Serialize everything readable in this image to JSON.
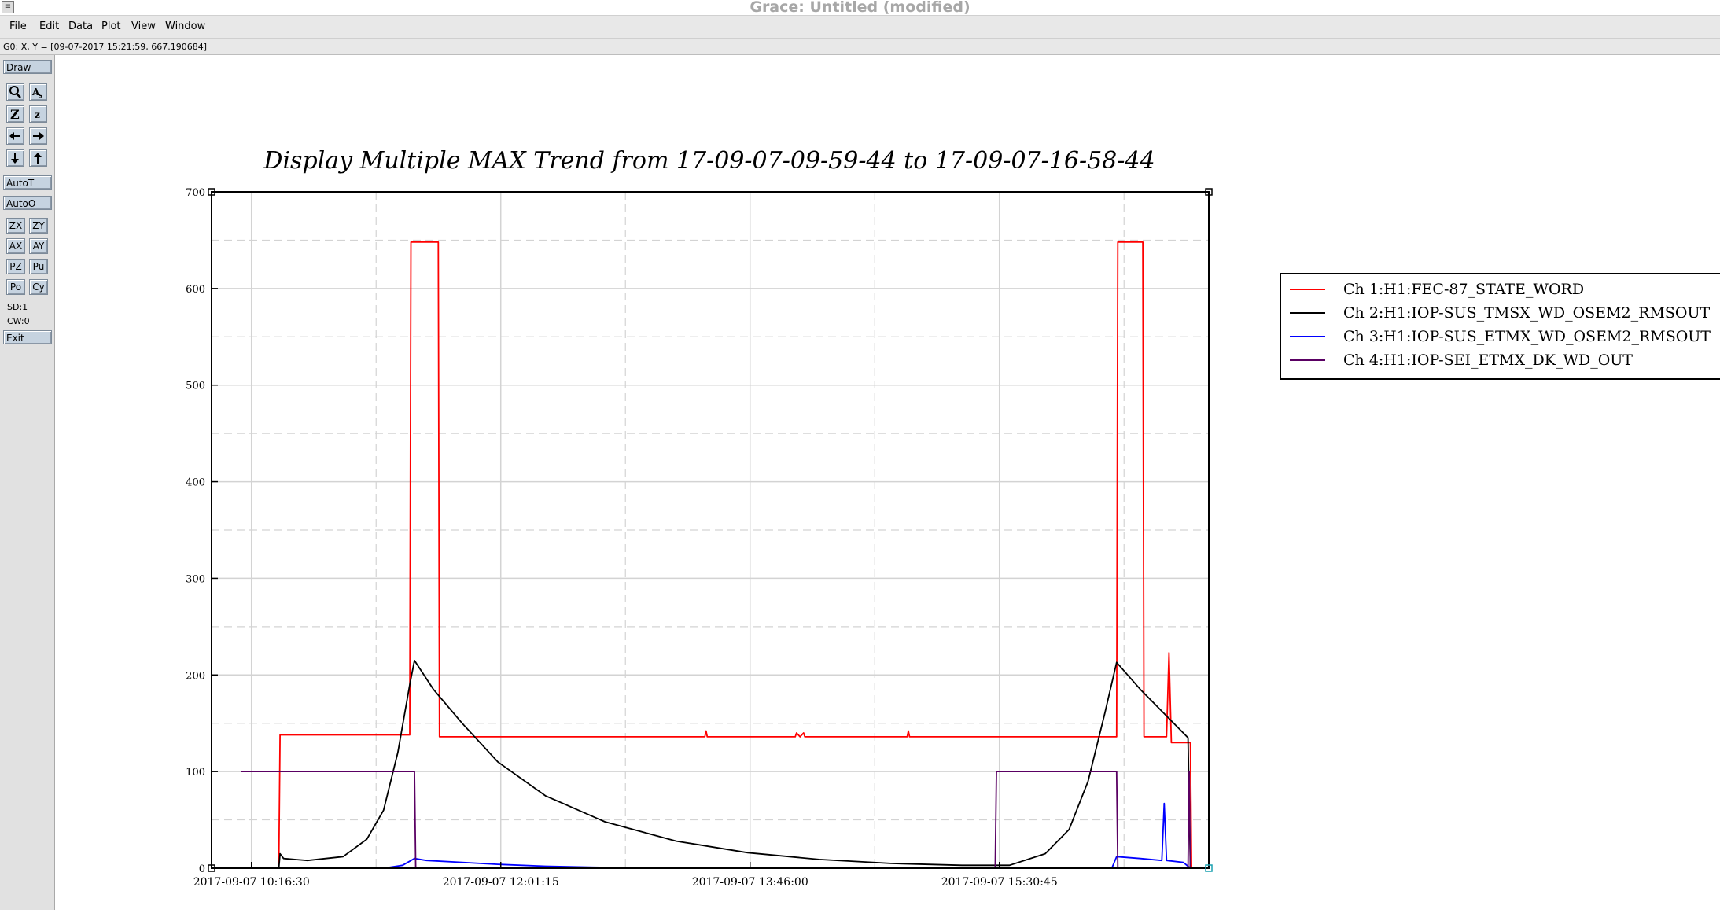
{
  "window": {
    "title": "Grace: Untitled (modified)"
  },
  "menu": {
    "items": [
      "File",
      "Edit",
      "Data",
      "Plot",
      "View",
      "Window"
    ]
  },
  "status": {
    "locator": "G0: X, Y = [09-07-2017 15:21:59, 667.190684]"
  },
  "toolbar": {
    "draw": "Draw",
    "autot": "AutoT",
    "autoo": "AutoO",
    "zx": "ZX",
    "zy": "ZY",
    "ax": "AX",
    "ay": "AY",
    "pz": "PZ",
    "pu": "Pu",
    "po": "Po",
    "cy": "Cy",
    "sd": "SD:1",
    "cw": "CW:0",
    "exit": "Exit",
    "icons": [
      "zoom-icon",
      "zoom-text-icon",
      "zoom-x-icon",
      "zoom-y-icon",
      "scroll-left-icon",
      "scroll-right-icon",
      "scroll-down-icon",
      "scroll-up-icon"
    ]
  },
  "chart_data": {
    "type": "line",
    "title": "Display Multiple MAX Trend from 17-09-07-09-59-44 to 17-09-07-16-58-44",
    "xlabel": "",
    "ylabel": "",
    "ylim": [
      0,
      700
    ],
    "yticks": [
      0,
      100,
      200,
      300,
      400,
      500,
      600,
      700
    ],
    "xlim": [
      "2017-09-07 09:59:44",
      "2017-09-07 16:58:44"
    ],
    "xtick_labels": [
      "2017-09-07 10:16:30",
      "2017-09-07 12:01:15",
      "2017-09-07 13:46:00",
      "2017-09-07 15:30:45"
    ],
    "grid": true,
    "legend_position": "right",
    "series": [
      {
        "name": "Ch 1:H1:FEC-87_STATE_WORD",
        "color": "#ff0000",
        "points": [
          [
            "2017-09-07 10:28:00",
            0
          ],
          [
            "2017-09-07 10:28:30",
            138
          ],
          [
            "2017-09-07 11:23:00",
            138
          ],
          [
            "2017-09-07 11:23:30",
            648
          ],
          [
            "2017-09-07 11:35:00",
            648
          ],
          [
            "2017-09-07 11:35:30",
            136
          ],
          [
            "2017-09-07 13:27:00",
            136
          ],
          [
            "2017-09-07 13:27:30",
            142
          ],
          [
            "2017-09-07 13:28:00",
            136
          ],
          [
            "2017-09-07 14:05:00",
            136
          ],
          [
            "2017-09-07 14:05:30",
            140
          ],
          [
            "2017-09-07 14:07:00",
            136
          ],
          [
            "2017-09-07 14:08:30",
            140
          ],
          [
            "2017-09-07 14:09:00",
            136
          ],
          [
            "2017-09-07 14:52:00",
            136
          ],
          [
            "2017-09-07 14:52:30",
            142
          ],
          [
            "2017-09-07 14:53:00",
            136
          ],
          [
            "2017-09-07 16:20:00",
            136
          ],
          [
            "2017-09-07 16:20:30",
            648
          ],
          [
            "2017-09-07 16:31:00",
            648
          ],
          [
            "2017-09-07 16:31:30",
            136
          ],
          [
            "2017-09-07 16:41:00",
            136
          ],
          [
            "2017-09-07 16:42:00",
            223
          ],
          [
            "2017-09-07 16:43:00",
            130
          ],
          [
            "2017-09-07 16:51:00",
            130
          ],
          [
            "2017-09-07 16:51:30",
            0
          ]
        ]
      },
      {
        "name": "Ch 2:H1:IOP-SUS_TMSX_WD_OSEM2_RMSOUT",
        "color": "#000000",
        "points": [
          [
            "2017-09-07 10:28:00",
            0
          ],
          [
            "2017-09-07 10:28:30",
            15
          ],
          [
            "2017-09-07 10:30:00",
            10
          ],
          [
            "2017-09-07 10:40:00",
            8
          ],
          [
            "2017-09-07 10:55:00",
            12
          ],
          [
            "2017-09-07 11:05:00",
            30
          ],
          [
            "2017-09-07 11:12:00",
            60
          ],
          [
            "2017-09-07 11:18:00",
            120
          ],
          [
            "2017-09-07 11:23:00",
            190
          ],
          [
            "2017-09-07 11:25:00",
            215
          ],
          [
            "2017-09-07 11:33:00",
            185
          ],
          [
            "2017-09-07 11:45:00",
            150
          ],
          [
            "2017-09-07 12:00:00",
            110
          ],
          [
            "2017-09-07 12:20:00",
            75
          ],
          [
            "2017-09-07 12:45:00",
            48
          ],
          [
            "2017-09-07 13:15:00",
            28
          ],
          [
            "2017-09-07 13:45:00",
            16
          ],
          [
            "2017-09-07 14:15:00",
            9
          ],
          [
            "2017-09-07 14:45:00",
            5
          ],
          [
            "2017-09-07 15:15:00",
            3
          ],
          [
            "2017-09-07 15:35:00",
            3
          ],
          [
            "2017-09-07 15:50:00",
            15
          ],
          [
            "2017-09-07 16:00:00",
            40
          ],
          [
            "2017-09-07 16:08:00",
            90
          ],
          [
            "2017-09-07 16:15:00",
            160
          ],
          [
            "2017-09-07 16:20:00",
            213
          ],
          [
            "2017-09-07 16:30:00",
            185
          ],
          [
            "2017-09-07 16:42:00",
            155
          ],
          [
            "2017-09-07 16:50:00",
            135
          ],
          [
            "2017-09-07 16:51:00",
            0
          ]
        ]
      },
      {
        "name": "Ch 3:H1:IOP-SUS_ETMX_WD_OSEM2_RMSOUT",
        "color": "#0000ff",
        "points": [
          [
            "2017-09-07 10:28:00",
            0
          ],
          [
            "2017-09-07 11:12:00",
            0
          ],
          [
            "2017-09-07 11:20:00",
            3
          ],
          [
            "2017-09-07 11:25:00",
            10
          ],
          [
            "2017-09-07 11:30:00",
            8
          ],
          [
            "2017-09-07 11:45:00",
            6
          ],
          [
            "2017-09-07 12:00:00",
            4
          ],
          [
            "2017-09-07 12:20:00",
            2
          ],
          [
            "2017-09-07 12:40:00",
            1
          ],
          [
            "2017-09-07 13:20:00",
            0
          ],
          [
            "2017-09-07 16:18:00",
            0
          ],
          [
            "2017-09-07 16:20:00",
            12
          ],
          [
            "2017-09-07 16:30:00",
            10
          ],
          [
            "2017-09-07 16:39:00",
            8
          ],
          [
            "2017-09-07 16:40:00",
            67
          ],
          [
            "2017-09-07 16:41:00",
            8
          ],
          [
            "2017-09-07 16:48:00",
            6
          ],
          [
            "2017-09-07 16:51:00",
            0
          ]
        ]
      },
      {
        "name": "Ch 4:H1:IOP-SEI_ETMX_DK_WD_OUT",
        "color": "#5a0063",
        "points": [
          [
            "2017-09-07 10:12:00",
            100
          ],
          [
            "2017-09-07 11:25:00",
            100
          ],
          [
            "2017-09-07 11:25:30",
            0
          ],
          [
            "2017-09-07 15:29:00",
            0
          ],
          [
            "2017-09-07 15:29:30",
            100
          ],
          [
            "2017-09-07 16:20:00",
            100
          ],
          [
            "2017-09-07 16:20:30",
            0
          ],
          [
            "2017-09-07 16:50:00",
            0
          ],
          [
            "2017-09-07 16:50:30",
            100
          ],
          [
            "2017-09-07 16:51:00",
            0
          ]
        ]
      }
    ]
  }
}
